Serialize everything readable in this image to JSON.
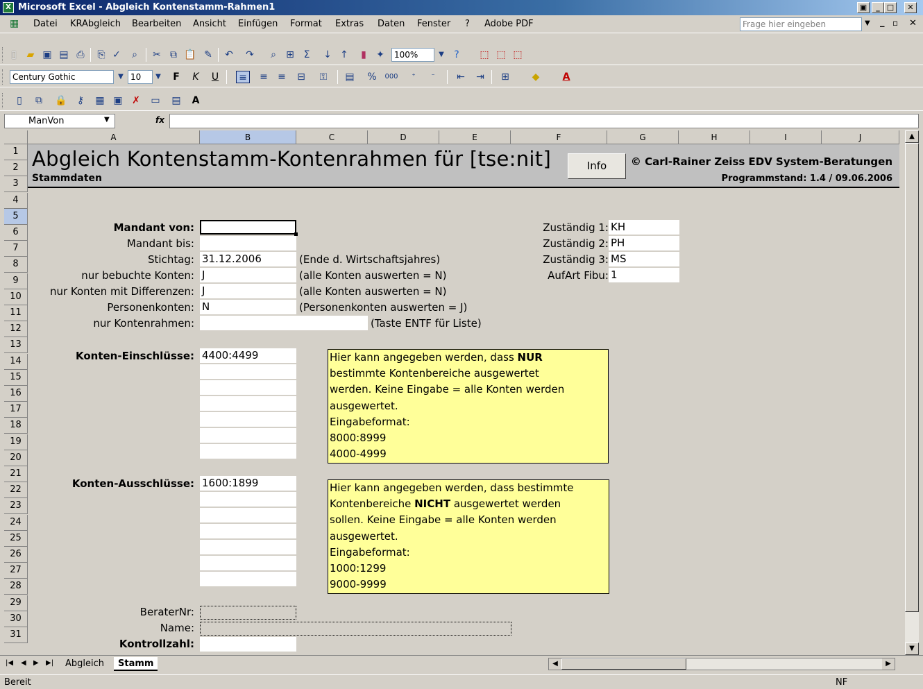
{
  "window": {
    "title": "Microsoft Excel - Abgleich Kontenstamm-Rahmen1"
  },
  "menu": {
    "items": [
      "Datei",
      "KRAbgleich",
      "Bearbeiten",
      "Ansicht",
      "Einfügen",
      "Format",
      "Extras",
      "Daten",
      "Fenster",
      "?",
      "Adobe PDF"
    ],
    "ask_placeholder": "Frage hier eingeben"
  },
  "toolbar": {
    "zoom": "100%",
    "font": "Century Gothic",
    "font_size": "10",
    "bold": "F",
    "italic": "K",
    "underline": "U",
    "percent": "%",
    "thousands": "000"
  },
  "formula": {
    "name_box": "ManVon",
    "fx": "fx"
  },
  "columns": [
    "A",
    "B",
    "C",
    "D",
    "E",
    "F",
    "G",
    "H",
    "I",
    "J"
  ],
  "rows": [
    "1",
    "2",
    "3",
    "4",
    "5",
    "6",
    "7",
    "8",
    "9",
    "10",
    "11",
    "12",
    "13",
    "14",
    "15",
    "16",
    "17",
    "18",
    "19",
    "20",
    "21",
    "22",
    "23",
    "24",
    "25",
    "26",
    "27",
    "28",
    "29",
    "30",
    "31"
  ],
  "sheet": {
    "title": "Abgleich Kontenstamm-Kontenrahmen für [tse:nit]",
    "subtitle": "Stammdaten",
    "info_button": "Info",
    "copyright": "© Carl-Rainer Zeiss EDV System-Beratungen",
    "version": "Programmstand: 1.4 / 09.06.2006",
    "fields": {
      "mandant_von": {
        "label": "Mandant von:",
        "value": ""
      },
      "mandant_bis": {
        "label": "Mandant bis:",
        "value": ""
      },
      "stichtag": {
        "label": "Stichtag:",
        "value": "31.12.2006",
        "note": "(Ende d. Wirtschaftsjahres)"
      },
      "bebuchte": {
        "label": "nur bebuchte Konten:",
        "value": "J",
        "note": "(alle Konten auswerten = N)"
      },
      "differenzen": {
        "label": "nur Konten mit Differenzen:",
        "value": "J",
        "note": "(alle Konten auswerten = N)"
      },
      "personen": {
        "label": "Personenkonten:",
        "value": "N",
        "note": "(Personenkonten auswerten = J)"
      },
      "kontenrahmen": {
        "label": "nur Kontenrahmen:",
        "value": "",
        "note": "(Taste ENTF für Liste)"
      },
      "einschluesse": {
        "label": "Konten-Einschlüsse:",
        "value": "4400:4499"
      },
      "ausschluesse": {
        "label": "Konten-Ausschlüsse:",
        "value": "1600:1899"
      },
      "beraternr": {
        "label": "BeraterNr:",
        "value": ""
      },
      "name": {
        "label": "Name:",
        "value": ""
      },
      "kontrollzahl": {
        "label": "Kontrollzahl:",
        "value": ""
      }
    },
    "zustaendig": [
      {
        "label": "Zuständig 1:",
        "value": "KH"
      },
      {
        "label": "Zuständig 2:",
        "value": "PH"
      },
      {
        "label": "Zuständig 3:",
        "value": "MS"
      },
      {
        "label": "AufArt Fibu:",
        "value": "1"
      }
    ],
    "note_include": {
      "l1_pre": "Hier kann angegeben werden, dass ",
      "l1_bold": "NUR",
      "l2": "bestimmte Kontenbereiche ausgewertet",
      "l3": "werden. Keine Eingabe = alle Konten werden",
      "l4": "ausgewertet.",
      "l5": "Eingabeformat:",
      "l6": "8000:8999",
      "l7": "4000-4999"
    },
    "note_exclude": {
      "l1": "Hier kann angegeben werden, dass bestimmte",
      "l2_pre": "Kontenbereiche ",
      "l2_bold": "NICHT",
      "l2_post": " ausgewertet werden",
      "l3": "sollen. Keine Eingabe = alle Konten werden",
      "l4": "ausgewertet.",
      "l5": "Eingabeformat:",
      "l6": "1000:1299",
      "l7": "9000-9999"
    }
  },
  "tabs": [
    "Abgleich",
    "Stamm"
  ],
  "status": {
    "left": "Bereit",
    "right": "NF"
  },
  "colors": {
    "title_start": "#0a246a",
    "note_bg": "#ffff99",
    "sheet_bg": "#d4d0c8"
  }
}
